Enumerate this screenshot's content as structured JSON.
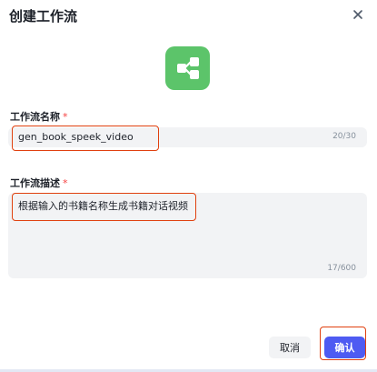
{
  "dialog": {
    "title": "创建工作流",
    "close_icon": "close-icon",
    "app_icon": "workflow-icon",
    "app_icon_color": "#5cc46a"
  },
  "form": {
    "name": {
      "label": "工作流名称",
      "required_mark": "*",
      "value": "gen_book_speek_video",
      "counter": "20/30"
    },
    "description": {
      "label": "工作流描述",
      "required_mark": "*",
      "value": "根据输入的书籍名称生成书籍对话视频",
      "counter": "17/600"
    }
  },
  "footer": {
    "cancel_label": "取消",
    "confirm_label": "确认",
    "confirm_color": "#4e5bf2"
  },
  "highlight_color": "#e0400e"
}
